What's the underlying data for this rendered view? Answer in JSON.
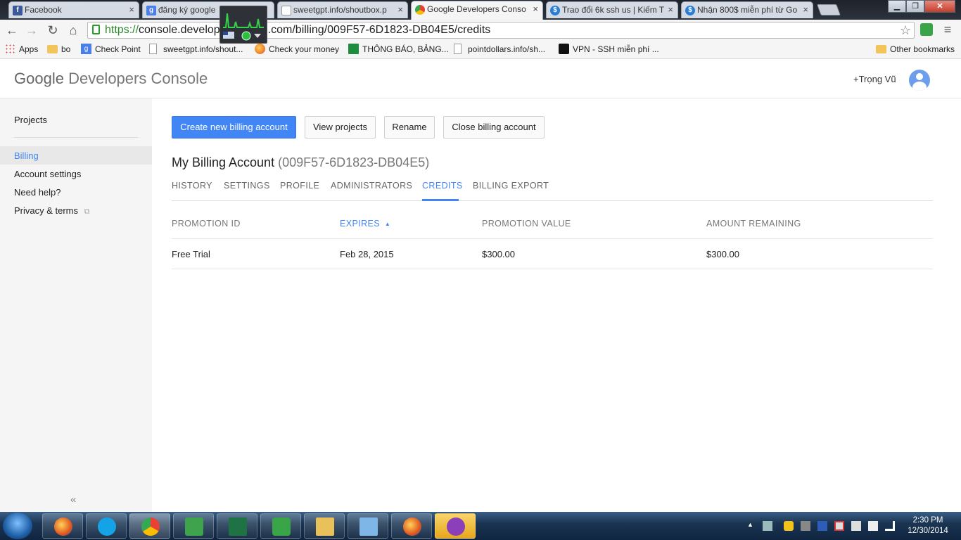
{
  "browser": {
    "tabs": [
      {
        "title": "Facebook",
        "favicon": "facebook-icon",
        "color": "#3b5998"
      },
      {
        "title": "đăng ký google",
        "favicon": "google-g-icon",
        "color": "#4a7ee8"
      },
      {
        "title": "sweetgpt.info/shoutbox.p",
        "favicon": "page-icon",
        "color": "#ffffff"
      },
      {
        "title": "Google Developers Conso",
        "favicon": "dev-console-icon",
        "color": "#e9a43a"
      },
      {
        "title": "Trao đổi 6k ssh us | Kiếm T",
        "favicon": "dollar-icon",
        "color": "#2a7fd4"
      },
      {
        "title": "Nhận 800$ miễn phí từ Go",
        "favicon": "dollar-icon",
        "color": "#2a7fd4"
      }
    ],
    "url": {
      "scheme": "https://",
      "host": "console.develop",
      "path": ".com/billing/009F57-6D1823-DB04E5/credits"
    },
    "bookmarks": [
      {
        "label": "Apps",
        "icon": "apps-grid-icon"
      },
      {
        "label": "bo",
        "icon": "folder-icon"
      },
      {
        "label": "Check Point",
        "icon": "google-g-icon"
      },
      {
        "label": "sweetgpt.info/shout...",
        "icon": "page-icon"
      },
      {
        "label": "Check your money",
        "icon": "ball-icon"
      },
      {
        "label": "THÔNG BÁO, BẢNG...",
        "icon": "sheet-icon"
      },
      {
        "label": "pointdollars.info/sh...",
        "icon": "page-icon"
      },
      {
        "label": "VPN - SSH miễn phí ...",
        "icon": "skull-icon"
      }
    ],
    "other_bookmarks": "Other bookmarks"
  },
  "app": {
    "logo_google": "Google",
    "logo_product": "Developers Console",
    "user_name": "+Trọng Vũ"
  },
  "sidebar": {
    "items": [
      {
        "label": "Projects"
      },
      {
        "label": "Billing",
        "selected": true
      },
      {
        "label": "Account settings"
      },
      {
        "label": "Need help?"
      },
      {
        "label": "Privacy & terms"
      }
    ],
    "collapse": "«"
  },
  "actions": {
    "create": "Create new billing account",
    "view_projects": "View projects",
    "rename": "Rename",
    "close": "Close billing account"
  },
  "account": {
    "name": "My Billing Account",
    "id": "(009F57-6D1823-DB04E5)"
  },
  "tabs": [
    {
      "label": "HISTORY"
    },
    {
      "label": "SETTINGS"
    },
    {
      "label": "PROFILE"
    },
    {
      "label": "ADMINISTRATORS"
    },
    {
      "label": "CREDITS",
      "active": true
    },
    {
      "label": "BILLING EXPORT"
    }
  ],
  "table": {
    "columns": [
      "PROMOTION ID",
      "EXPIRES",
      "PROMOTION VALUE",
      "AMOUNT REMAINING"
    ],
    "sort_indicator": "▲",
    "rows": [
      [
        "Free Trial",
        "Feb 28, 2015",
        "$300.00",
        "$300.00"
      ]
    ]
  },
  "taskbar": {
    "apps": [
      "firefox-icon",
      "skype-icon",
      "chrome-icon",
      "check-icon",
      "excel-icon",
      "robot-icon",
      "explorer-icon",
      "notepad-icon",
      "firefox-icon",
      "yahoo-messenger-icon"
    ],
    "time": "2:30 PM",
    "date": "12/30/2014"
  },
  "colors": {
    "accent": "#4285f4",
    "sidebar_bg": "#f5f5f5"
  }
}
